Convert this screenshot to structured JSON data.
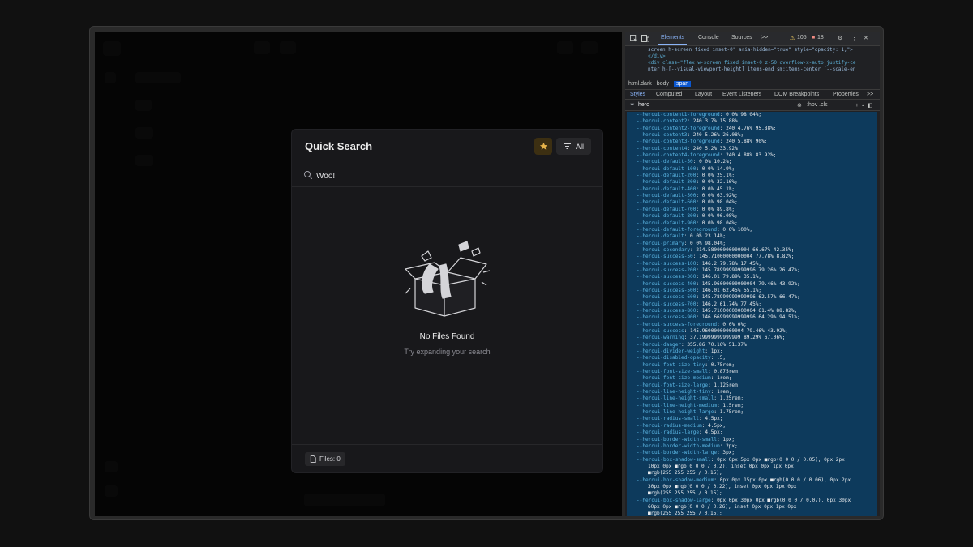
{
  "modal": {
    "title": "Quick Search",
    "filter_label": "All",
    "search_value": "Woo!",
    "empty_title": "No Files Found",
    "empty_subtitle": "Try expanding your search",
    "files_count": "Files: 0"
  },
  "colors": {
    "star_accent": "#e8b44a",
    "devtools_selection": "#0d3a5c"
  },
  "devtools": {
    "tabs": [
      "Elements",
      "Console",
      "Sources"
    ],
    "more": ">>",
    "warnings": "105",
    "errors": "18",
    "html_lines": [
      "screen h-screen fixed inset-0\" aria-hidden=\"true\" style=\"opacity: 1;\">",
      "</div>",
      "<div class=\"flex w-screen fixed inset-0 z-50 overflow-x-auto justify-ce",
      "nter h-[--visual-viewport-height] items-end sm:items-center [--scale-en"
    ],
    "breadcrumbs": [
      "html.dark",
      "body",
      "span"
    ],
    "subtabs": [
      "Styles",
      "Computed",
      "Layout",
      "Event Listeners",
      "DOM Breakpoints",
      "Properties",
      ">>"
    ],
    "filter_text": "hero",
    "filter_tools": ":hov .cls",
    "vars": [
      [
        "--heroui-content1-foreground",
        "0 0% 98.04%;"
      ],
      [
        "--heroui-content2",
        "240 3.7% 15.88%;"
      ],
      [
        "--heroui-content2-foreground",
        "240 4.76% 95.88%;"
      ],
      [
        "--heroui-content3",
        "240 5.26% 26.08%;"
      ],
      [
        "--heroui-content3-foreground",
        "240 5.88% 90%;"
      ],
      [
        "--heroui-content4",
        "240 5.2% 33.92%;"
      ],
      [
        "--heroui-content4-foreground",
        "240 4.88% 83.92%;"
      ],
      [
        "--heroui-default-50",
        "0 0% 10.2%;"
      ],
      [
        "--heroui-default-100",
        "0 0% 14.9%;"
      ],
      [
        "--heroui-default-200",
        "0 0% 25.1%;"
      ],
      [
        "--heroui-default-300",
        "0 0% 32.16%;"
      ],
      [
        "--heroui-default-400",
        "0 0% 45.1%;"
      ],
      [
        "--heroui-default-500",
        "0 0% 63.92%;"
      ],
      [
        "--heroui-default-600",
        "0 0% 98.04%;"
      ],
      [
        "--heroui-default-700",
        "0 0% 89.8%;"
      ],
      [
        "--heroui-default-800",
        "0 0% 96.08%;"
      ],
      [
        "--heroui-default-900",
        "0 0% 98.04%;"
      ],
      [
        "--heroui-default-foreground",
        "0 0% 100%;"
      ],
      [
        "--heroui-default",
        "0 0% 23.14%;"
      ],
      [
        "--heroui-primary",
        "0 0% 98.04%;"
      ],
      [
        "--heroui-secondary",
        "214.58000000000004 66.67% 42.35%;"
      ],
      [
        "--heroui-success-50",
        "145.71000000000004 77.78% 8.82%;"
      ],
      [
        "--heroui-success-100",
        "146.2 79.78% 17.45%;"
      ],
      [
        "--heroui-success-200",
        "145.78999999999996 79.26% 26.47%;"
      ],
      [
        "--heroui-success-300",
        "146.01 79.89% 35.1%;"
      ],
      [
        "--heroui-success-400",
        "145.96000000000004 79.46% 43.92%;"
      ],
      [
        "--heroui-success-500",
        "146.01 62.45% 55.1%;"
      ],
      [
        "--heroui-success-600",
        "145.78999999999996 62.57% 66.47%;"
      ],
      [
        "--heroui-success-700",
        "146.2 61.74% 77.45%;"
      ],
      [
        "--heroui-success-800",
        "145.71000000000004 61.4% 88.82%;"
      ],
      [
        "--heroui-success-900",
        "146.66999999999996 64.29% 94.51%;"
      ],
      [
        "--heroui-success-foreground",
        "0 0% 0%;"
      ],
      [
        "--heroui-success",
        "145.96000000000004 79.46% 43.92%;"
      ],
      [
        "--heroui-warning",
        "37.19999999999999 89.29% 67.06%;"
      ],
      [
        "--heroui-danger",
        "355.86 70.16% 51.37%;"
      ],
      [
        "--heroui-divider-weight",
        "1px;"
      ],
      [
        "--heroui-disabled-opacity",
        ".5;"
      ],
      [
        "--heroui-font-size-tiny",
        "0.75rem;"
      ],
      [
        "--heroui-font-size-small",
        "0.875rem;"
      ],
      [
        "--heroui-font-size-medium",
        "1rem;"
      ],
      [
        "--heroui-font-size-large",
        "1.125rem;"
      ],
      [
        "--heroui-line-height-tiny",
        "1rem;"
      ],
      [
        "--heroui-line-height-small",
        "1.25rem;"
      ],
      [
        "--heroui-line-height-medium",
        "1.5rem;"
      ],
      [
        "--heroui-line-height-large",
        "1.75rem;"
      ],
      [
        "--heroui-radius-small",
        "4.5px;"
      ],
      [
        "--heroui-radius-medium",
        "4.5px;"
      ],
      [
        "--heroui-radius-large",
        "4.5px;"
      ],
      [
        "--heroui-border-width-small",
        "1px;"
      ],
      [
        "--heroui-border-width-medium",
        "2px;"
      ],
      [
        "--heroui-border-width-large",
        "3px;"
      ],
      [
        "--heroui-box-shadow-small",
        "0px 0px 5px 0px ■rgb(0 0 0 / 0.05), 0px 2px"
      ],
      [
        "",
        "10px 0px ■rgb(0 0 0 / 0.2), inset 0px 0px 1px 0px"
      ],
      [
        "",
        "■rgb(255 255 255 / 0.15);"
      ],
      [
        "--heroui-box-shadow-medium",
        "0px 0px 15px 0px ■rgb(0 0 0 / 0.06), 0px 2px"
      ],
      [
        "",
        "30px 0px ■rgb(0 0 0 / 0.22), inset 0px 0px 1px 0px"
      ],
      [
        "",
        "■rgb(255 255 255 / 0.15);"
      ],
      [
        "--heroui-box-shadow-large",
        "0px 0px 30px 0px ■rgb(0 0 0 / 0.07), 0px 30px"
      ],
      [
        "",
        "60px 0px ■rgb(0 0 0 / 0.26), inset 0px 0px 1px 0px"
      ],
      [
        "",
        "■rgb(255 255 255 / 0.15);"
      ]
    ]
  }
}
